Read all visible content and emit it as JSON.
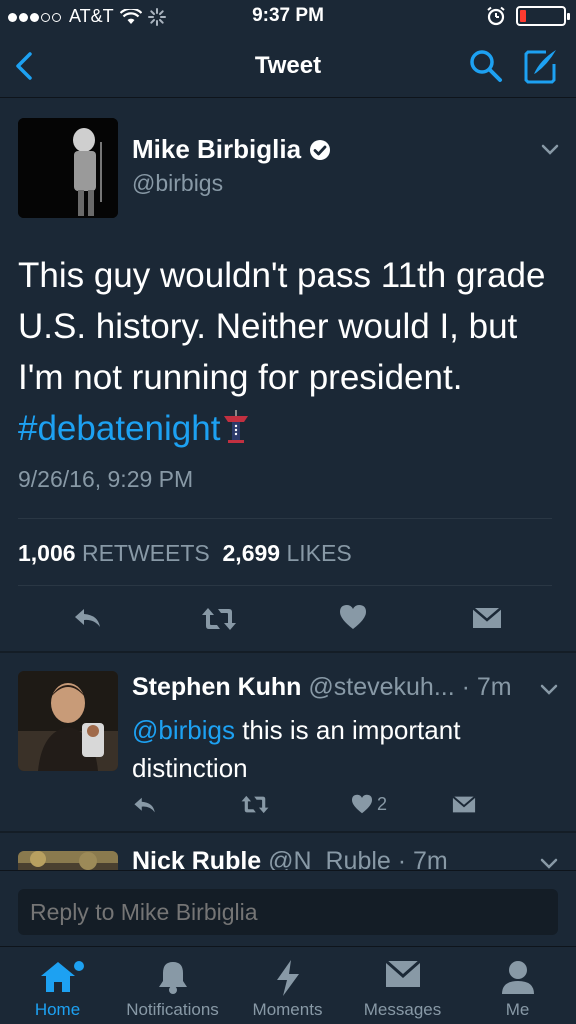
{
  "status_bar": {
    "carrier": "AT&T",
    "time": "9:37 PM",
    "battery_color": "#ff3b30"
  },
  "nav": {
    "title": "Tweet",
    "back_icon": "chevron-left-icon",
    "search_icon": "search-icon",
    "compose_icon": "compose-icon"
  },
  "tweet": {
    "author_name": "Mike Birbiglia",
    "handle": "@birbigs",
    "verified": true,
    "text_before_hashtag": "This guy wouldn't pass 11th grade U.S. history. Neither would I, but I'm not running for president. ",
    "hashtag": "#debatenight",
    "timestamp": "9/26/16, 9:29 PM",
    "retweet_count": "1,006",
    "retweet_label": "RETWEETS",
    "like_count": "2,699",
    "like_label": "LIKES"
  },
  "replies": [
    {
      "name": "Stephen Kuhn",
      "handle_time": "@stevekuh... · 7m",
      "mention": "@birbigs",
      "text": " this is an important distinction",
      "like_count": "2"
    },
    {
      "name": "Nick Ruble",
      "handle_time": "@N_Ruble · 7m"
    }
  ],
  "reply_box": {
    "placeholder": "Reply to Mike Birbiglia"
  },
  "tabs": [
    {
      "label": "Home",
      "icon": "home-icon",
      "active": true
    },
    {
      "label": "Notifications",
      "icon": "bell-icon",
      "active": false
    },
    {
      "label": "Moments",
      "icon": "lightning-icon",
      "active": false
    },
    {
      "label": "Messages",
      "icon": "envelope-icon",
      "active": false
    },
    {
      "label": "Me",
      "icon": "person-icon",
      "active": false
    }
  ],
  "colors": {
    "accent": "#1da1f2",
    "background": "#141d26",
    "card": "#1b2836",
    "secondary_text": "#8899a6"
  }
}
